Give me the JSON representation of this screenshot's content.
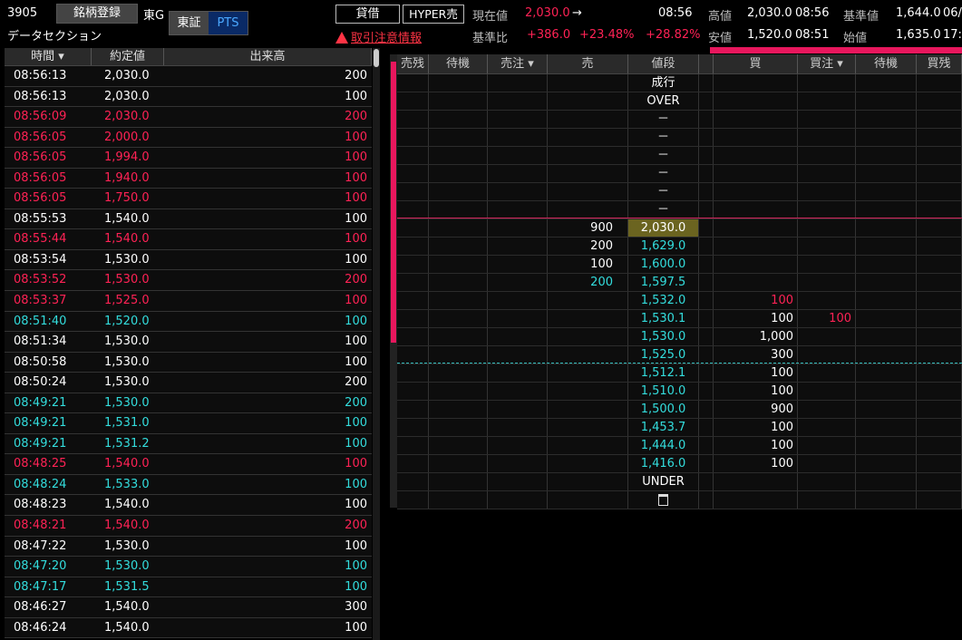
{
  "header": {
    "code": "3905",
    "register_label": "銘柄登録",
    "market": "東G",
    "exchange_tse": "東証",
    "exchange_pts": "PTS",
    "name": "データセクション",
    "taishaku_label": "貸借",
    "hyper_label": "HYPER売",
    "warning_label": "取引注意情報",
    "current_label": "現在値",
    "current_value": "2,030.0",
    "current_arrow": "→",
    "time": "08:56",
    "prev_label": "基準比",
    "change_value": "+386.0",
    "change_pct": "+23.48%",
    "change_pct2": "+28.82%",
    "high_label": "高値",
    "high_value": "2,030.0",
    "high_time": "08:56",
    "low_label": "安値",
    "low_value": "1,520.0",
    "low_time": "08:51",
    "base_label": "基準値",
    "base_value": "1,644.0",
    "base_extra": "06/",
    "open_label": "始値",
    "open_value": "1,635.0",
    "open_extra": "17:"
  },
  "trades": {
    "headers": [
      "時間",
      "約定値",
      "出来高"
    ],
    "rows": [
      {
        "time": "08:56:13",
        "price": "2,030.0",
        "vol": "200",
        "c": "white"
      },
      {
        "time": "08:56:13",
        "price": "2,030.0",
        "vol": "100",
        "c": "white"
      },
      {
        "time": "08:56:09",
        "price": "2,030.0",
        "vol": "200",
        "c": "red"
      },
      {
        "time": "08:56:05",
        "price": "2,000.0",
        "vol": "100",
        "c": "red"
      },
      {
        "time": "08:56:05",
        "price": "1,994.0",
        "vol": "100",
        "c": "red"
      },
      {
        "time": "08:56:05",
        "price": "1,940.0",
        "vol": "100",
        "c": "red"
      },
      {
        "time": "08:56:05",
        "price": "1,750.0",
        "vol": "100",
        "c": "red"
      },
      {
        "time": "08:55:53",
        "price": "1,540.0",
        "vol": "100",
        "c": "white"
      },
      {
        "time": "08:55:44",
        "price": "1,540.0",
        "vol": "100",
        "c": "red"
      },
      {
        "time": "08:53:54",
        "price": "1,530.0",
        "vol": "100",
        "c": "white"
      },
      {
        "time": "08:53:52",
        "price": "1,530.0",
        "vol": "200",
        "c": "red"
      },
      {
        "time": "08:53:37",
        "price": "1,525.0",
        "vol": "100",
        "c": "red"
      },
      {
        "time": "08:51:40",
        "price": "1,520.0",
        "vol": "100",
        "c": "cyan"
      },
      {
        "time": "08:51:34",
        "price": "1,530.0",
        "vol": "100",
        "c": "white"
      },
      {
        "time": "08:50:58",
        "price": "1,530.0",
        "vol": "100",
        "c": "white"
      },
      {
        "time": "08:50:24",
        "price": "1,530.0",
        "vol": "200",
        "c": "white"
      },
      {
        "time": "08:49:21",
        "price": "1,530.0",
        "vol": "200",
        "c": "cyan"
      },
      {
        "time": "08:49:21",
        "price": "1,531.0",
        "vol": "100",
        "c": "cyan"
      },
      {
        "time": "08:49:21",
        "price": "1,531.2",
        "vol": "100",
        "c": "cyan"
      },
      {
        "time": "08:48:25",
        "price": "1,540.0",
        "vol": "100",
        "c": "red"
      },
      {
        "time": "08:48:24",
        "price": "1,533.0",
        "vol": "100",
        "c": "cyan"
      },
      {
        "time": "08:48:23",
        "price": "1,540.0",
        "vol": "100",
        "c": "white"
      },
      {
        "time": "08:48:21",
        "price": "1,540.0",
        "vol": "200",
        "c": "red"
      },
      {
        "time": "08:47:22",
        "price": "1,530.0",
        "vol": "100",
        "c": "white"
      },
      {
        "time": "08:47:20",
        "price": "1,530.0",
        "vol": "100",
        "c": "cyan"
      },
      {
        "time": "08:47:17",
        "price": "1,531.5",
        "vol": "100",
        "c": "cyan"
      },
      {
        "time": "08:46:27",
        "price": "1,540.0",
        "vol": "300",
        "c": "white"
      },
      {
        "time": "08:46:24",
        "price": "1,540.0",
        "vol": "100",
        "c": "white"
      }
    ]
  },
  "board": {
    "headers": [
      "売残",
      "待機",
      "売注",
      "売",
      "値段",
      "買",
      "買注",
      "待機",
      "買残"
    ],
    "rows": [
      {
        "sell": "",
        "sc": "white",
        "price": "成行",
        "pc": "white",
        "buy": "",
        "bc": "white",
        "buyord": "",
        "hl": false
      },
      {
        "sell": "",
        "sc": "white",
        "price": "OVER",
        "pc": "white",
        "buy": "",
        "bc": "white",
        "buyord": "",
        "hl": false
      },
      {
        "sell": "",
        "sc": "white",
        "price": "－",
        "pc": "white",
        "buy": "",
        "bc": "white",
        "buyord": "",
        "hl": false
      },
      {
        "sell": "",
        "sc": "white",
        "price": "－",
        "pc": "white",
        "buy": "",
        "bc": "white",
        "buyord": "",
        "hl": false
      },
      {
        "sell": "",
        "sc": "white",
        "price": "－",
        "pc": "white",
        "buy": "",
        "bc": "white",
        "buyord": "",
        "hl": false
      },
      {
        "sell": "",
        "sc": "white",
        "price": "－",
        "pc": "white",
        "buy": "",
        "bc": "white",
        "buyord": "",
        "hl": false
      },
      {
        "sell": "",
        "sc": "white",
        "price": "－",
        "pc": "white",
        "buy": "",
        "bc": "white",
        "buyord": "",
        "hl": false
      },
      {
        "sell": "",
        "sc": "white",
        "price": "－",
        "pc": "white",
        "buy": "",
        "bc": "white",
        "buyord": "",
        "hl": false
      },
      {
        "sell": "900",
        "sc": "white",
        "price": "2,030.0",
        "pc": "white",
        "buy": "",
        "bc": "white",
        "buyord": "",
        "hl": true
      },
      {
        "sell": "200",
        "sc": "white",
        "price": "1,629.0",
        "pc": "cyan",
        "buy": "",
        "bc": "white",
        "buyord": "",
        "hl": false
      },
      {
        "sell": "100",
        "sc": "white",
        "price": "1,600.0",
        "pc": "cyan",
        "buy": "",
        "bc": "white",
        "buyord": "",
        "hl": false
      },
      {
        "sell": "200",
        "sc": "cyan",
        "price": "1,597.5",
        "pc": "cyan",
        "buy": "",
        "bc": "white",
        "buyord": "",
        "hl": false
      },
      {
        "sell": "",
        "sc": "white",
        "price": "1,532.0",
        "pc": "cyan",
        "buy": "100",
        "bc": "red",
        "buyord": "",
        "hl": false
      },
      {
        "sell": "",
        "sc": "white",
        "price": "1,530.1",
        "pc": "cyan",
        "buy": "100",
        "bc": "white",
        "buyord": "100",
        "hl": false
      },
      {
        "sell": "",
        "sc": "white",
        "price": "1,530.0",
        "pc": "cyan",
        "buy": "1,000",
        "bc": "white",
        "buyord": "",
        "hl": false
      },
      {
        "sell": "",
        "sc": "white",
        "price": "1,525.0",
        "pc": "cyan",
        "buy": "300",
        "bc": "white",
        "buyord": "",
        "hl": false
      },
      {
        "sell": "",
        "sc": "white",
        "price": "1,512.1",
        "pc": "cyan",
        "buy": "100",
        "bc": "white",
        "buyord": "",
        "hl": false
      },
      {
        "sell": "",
        "sc": "white",
        "price": "1,510.0",
        "pc": "cyan",
        "buy": "100",
        "bc": "white",
        "buyord": "",
        "hl": false
      },
      {
        "sell": "",
        "sc": "white",
        "price": "1,500.0",
        "pc": "cyan",
        "buy": "900",
        "bc": "white",
        "buyord": "",
        "hl": false
      },
      {
        "sell": "",
        "sc": "white",
        "price": "1,453.7",
        "pc": "cyan",
        "buy": "100",
        "bc": "white",
        "buyord": "",
        "hl": false
      },
      {
        "sell": "",
        "sc": "white",
        "price": "1,444.0",
        "pc": "cyan",
        "buy": "100",
        "bc": "white",
        "buyord": "",
        "hl": false
      },
      {
        "sell": "",
        "sc": "white",
        "price": "1,416.0",
        "pc": "cyan",
        "buy": "100",
        "bc": "white",
        "buyord": "",
        "hl": false
      },
      {
        "sell": "",
        "sc": "white",
        "price": "UNDER",
        "pc": "white",
        "buy": "",
        "bc": "white",
        "buyord": "",
        "hl": false
      }
    ],
    "trash_icon": "trash-icon"
  },
  "colors": {
    "red": "#ff2255",
    "cyan": "#33dddd",
    "highlight": "#6b6420",
    "accent": "#e8175d"
  }
}
